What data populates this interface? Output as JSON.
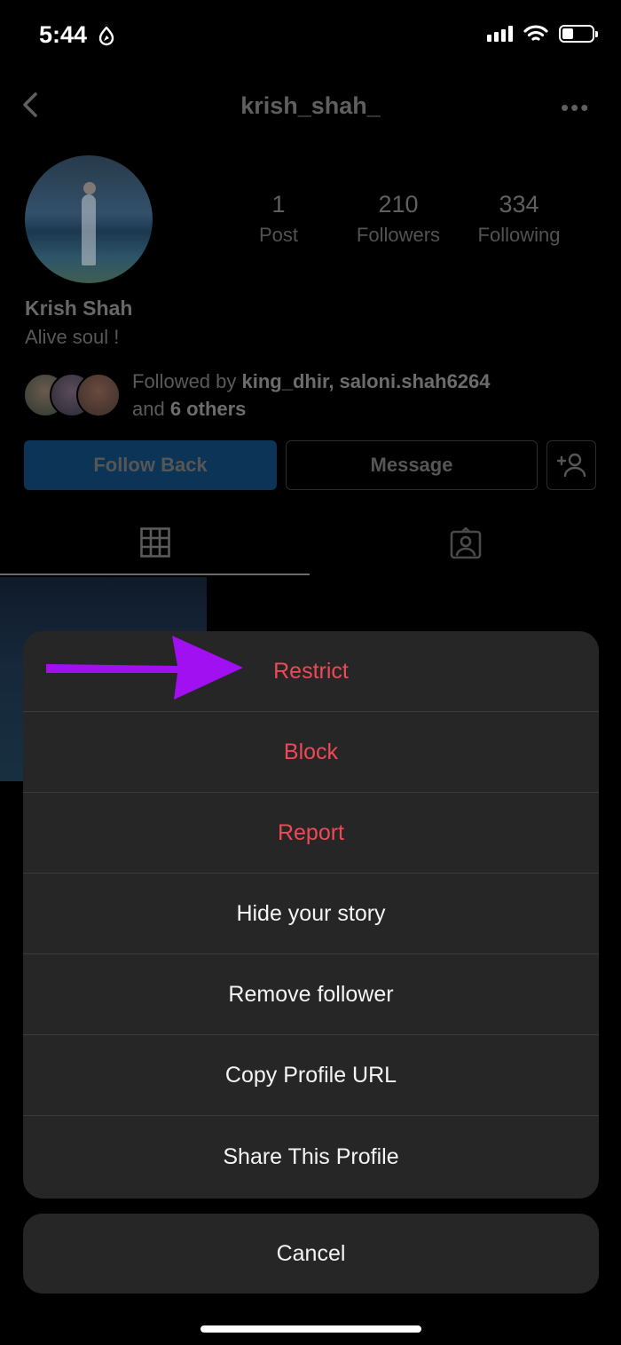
{
  "status_bar": {
    "time": "5:44"
  },
  "profile": {
    "username": "krish_shah_",
    "display_name": "Krish Shah",
    "bio": "Alive soul !",
    "stats": [
      {
        "value": "1",
        "label": "Post"
      },
      {
        "value": "210",
        "label": "Followers"
      },
      {
        "value": "334",
        "label": "Following"
      }
    ],
    "followed_by": {
      "prefix": "Followed by ",
      "names": "king_dhir, saloni.shah6264",
      "and_text": "and ",
      "others": "6 others"
    },
    "buttons": {
      "follow_back": "Follow Back",
      "message": "Message"
    }
  },
  "action_sheet": {
    "items": [
      {
        "label": "Restrict",
        "style": "danger"
      },
      {
        "label": "Block",
        "style": "danger"
      },
      {
        "label": "Report",
        "style": "danger"
      },
      {
        "label": "Hide your story",
        "style": "default"
      },
      {
        "label": "Remove follower",
        "style": "default"
      },
      {
        "label": "Copy Profile URL",
        "style": "default"
      },
      {
        "label": "Share This Profile",
        "style": "default"
      }
    ],
    "cancel": "Cancel"
  },
  "colors": {
    "danger": "#ed4956",
    "sheet_bg": "#262626",
    "annotation_arrow": "#a010f0"
  }
}
